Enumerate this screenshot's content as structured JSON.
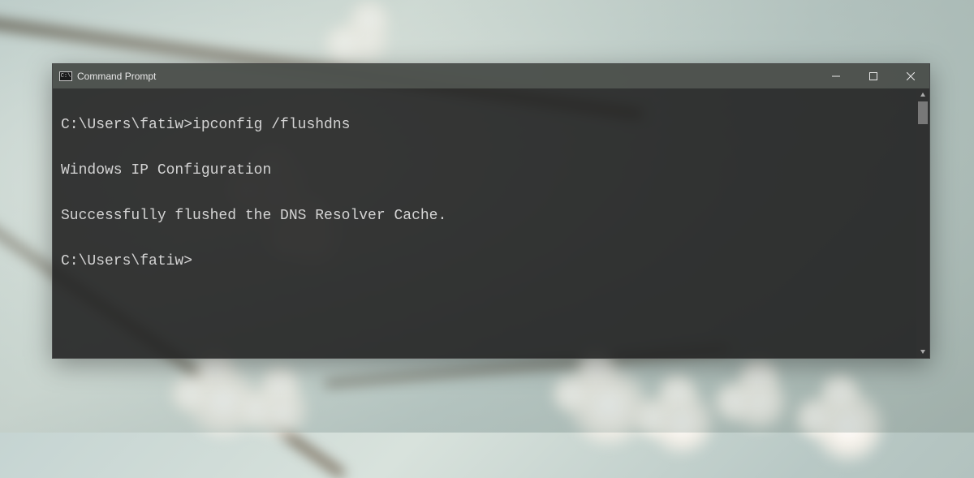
{
  "window": {
    "title": "Command Prompt"
  },
  "terminal": {
    "prompt1": "C:\\Users\\fatiw>",
    "command1": "ipconfig /flushdns",
    "output_header": "Windows IP Configuration",
    "output_message": "Successfully flushed the DNS Resolver Cache.",
    "prompt2": "C:\\Users\\fatiw>"
  }
}
